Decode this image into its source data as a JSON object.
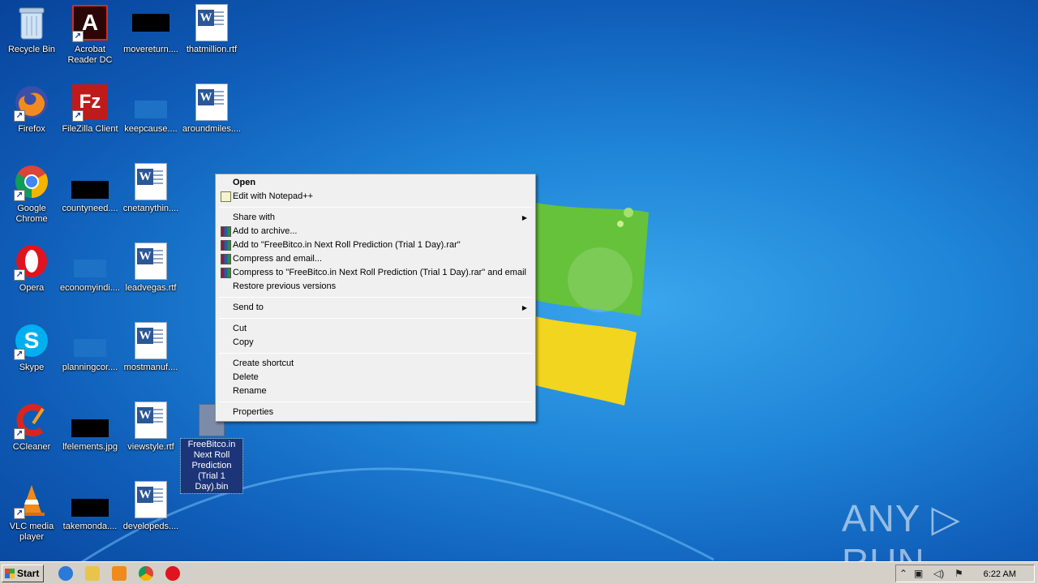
{
  "desktop": {
    "icons": [
      {
        "label": "Recycle Bin"
      },
      {
        "label": "Acrobat Reader DC"
      },
      {
        "label": "movereturn...."
      },
      {
        "label": "thatmillion.rtf"
      },
      {
        "label": "Firefox"
      },
      {
        "label": "FileZilla Client"
      },
      {
        "label": "keepcause...."
      },
      {
        "label": "aroundmiles...."
      },
      {
        "label": "Google Chrome"
      },
      {
        "label": "countyneed...."
      },
      {
        "label": "cnetanythin...."
      },
      {
        "label": "Opera"
      },
      {
        "label": "economyindi...."
      },
      {
        "label": "leadvegas.rtf"
      },
      {
        "label": "Skype"
      },
      {
        "label": "planningcor...."
      },
      {
        "label": "mostmanuf...."
      },
      {
        "label": "CCleaner"
      },
      {
        "label": "lfelements.jpg"
      },
      {
        "label": "viewstyle.rtf"
      },
      {
        "label": "FreeBitco.in Next Roll Prediction (Trial 1 Day).bin"
      },
      {
        "label": "VLC media player"
      },
      {
        "label": "takemonda...."
      },
      {
        "label": "developeds...."
      }
    ]
  },
  "context_menu": {
    "items": [
      {
        "label": "Open"
      },
      {
        "label": "Edit with Notepad++"
      },
      {
        "label": "Share with"
      },
      {
        "label": "Add to archive..."
      },
      {
        "label": "Add to \"FreeBitco.in Next Roll Prediction (Trial 1 Day).rar\""
      },
      {
        "label": "Compress and email..."
      },
      {
        "label": "Compress to \"FreeBitco.in Next Roll Prediction (Trial 1 Day).rar\" and email"
      },
      {
        "label": "Restore previous versions"
      },
      {
        "label": "Send to"
      },
      {
        "label": "Cut"
      },
      {
        "label": "Copy"
      },
      {
        "label": "Create shortcut"
      },
      {
        "label": "Delete"
      },
      {
        "label": "Rename"
      },
      {
        "label": "Properties"
      }
    ],
    "submenu_arrow": "▶"
  },
  "taskbar": {
    "start_label": "Start",
    "clock": "6:22 AM"
  },
  "watermark": "ANY ▷ RUN",
  "colors": {
    "desktop_blue": "#1f86d8",
    "selection": "#1c3478",
    "menu_bg": "#f0f0f0",
    "taskbar_bg": "#d4d0c8"
  }
}
